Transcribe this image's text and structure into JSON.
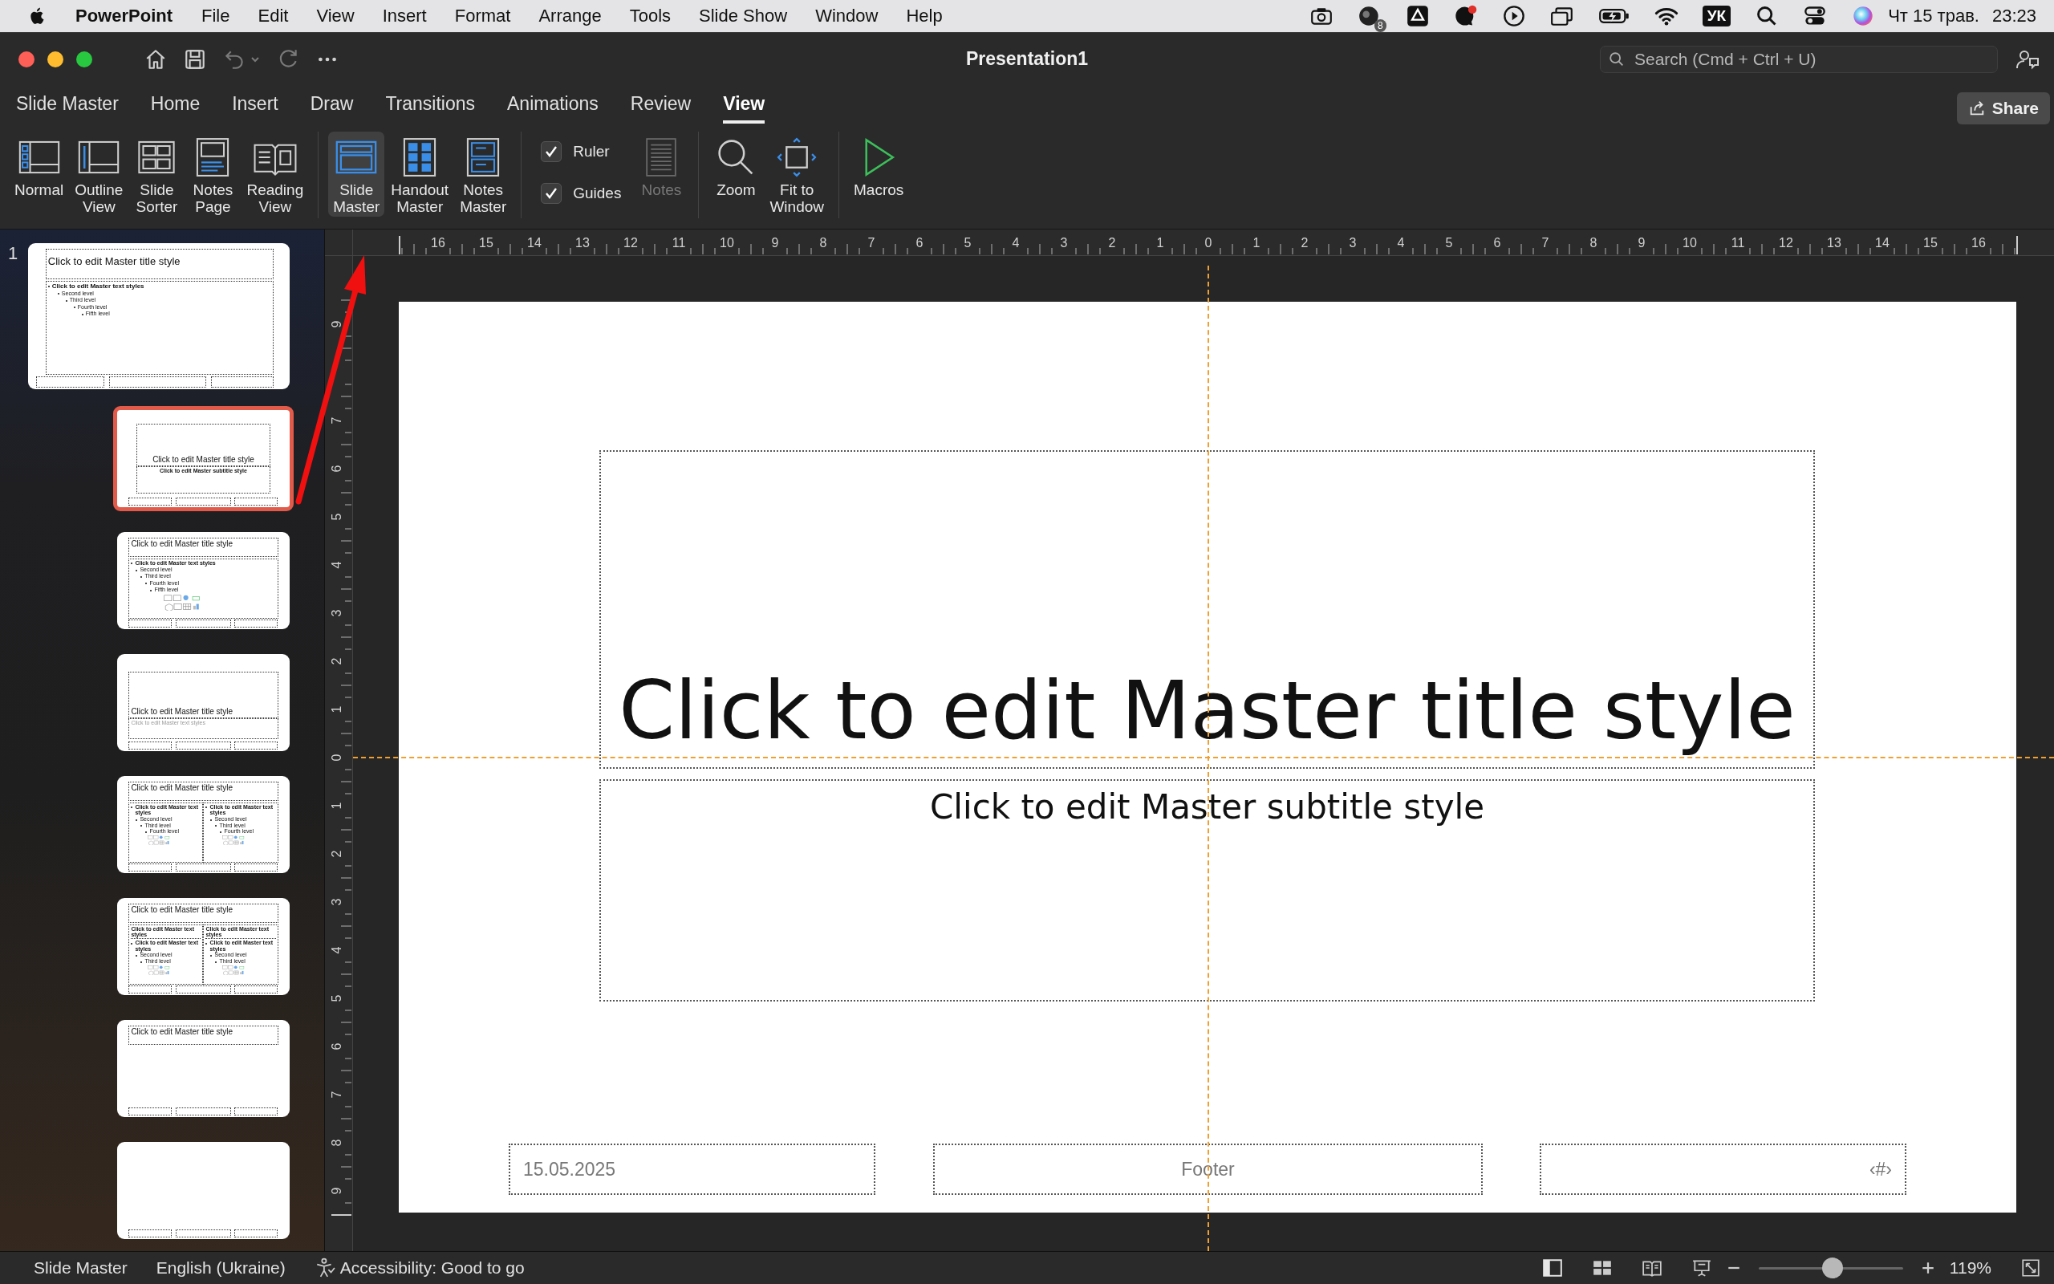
{
  "menubar": {
    "app_name": "PowerPoint",
    "menus": [
      "File",
      "Edit",
      "View",
      "Insert",
      "Format",
      "Arrange",
      "Tools",
      "Slide Show",
      "Window",
      "Help"
    ],
    "notification_badge": "8",
    "input_source": "УК",
    "date": "Чт 15 трав.",
    "time": "23:23"
  },
  "window": {
    "title": "Presentation1",
    "search": {
      "placeholder": "Search (Cmd + Ctrl + U)"
    }
  },
  "tabs": [
    {
      "label": "Slide Master",
      "selected": false
    },
    {
      "label": "Home",
      "selected": false
    },
    {
      "label": "Insert",
      "selected": false
    },
    {
      "label": "Draw",
      "selected": false
    },
    {
      "label": "Transitions",
      "selected": false
    },
    {
      "label": "Animations",
      "selected": false
    },
    {
      "label": "Review",
      "selected": false
    },
    {
      "label": "View",
      "selected": true
    }
  ],
  "share_button": "Share",
  "ribbon": {
    "groups": [
      {
        "items": [
          {
            "kind": "button",
            "label": [
              "Normal"
            ],
            "selected": false,
            "disabled": false
          },
          {
            "kind": "button",
            "label": [
              "Outline",
              "View"
            ],
            "selected": false,
            "disabled": false
          },
          {
            "kind": "button",
            "label": [
              "Slide",
              "Sorter"
            ],
            "selected": false,
            "disabled": false
          },
          {
            "kind": "button",
            "label": [
              "Notes",
              "Page"
            ],
            "selected": false,
            "disabled": false
          },
          {
            "kind": "button",
            "label": [
              "Reading",
              "View"
            ],
            "selected": false,
            "disabled": false
          }
        ]
      },
      {
        "items": [
          {
            "kind": "button",
            "label": [
              "Slide",
              "Master"
            ],
            "selected": true,
            "disabled": false
          },
          {
            "kind": "button",
            "label": [
              "Handout",
              "Master"
            ],
            "selected": false,
            "disabled": false
          },
          {
            "kind": "button",
            "label": [
              "Notes",
              "Master"
            ],
            "selected": false,
            "disabled": false
          }
        ]
      },
      {
        "items": [
          {
            "kind": "checkbox",
            "label": "Ruler",
            "checked": true
          },
          {
            "kind": "checkbox",
            "label": "Guides",
            "checked": true
          },
          {
            "kind": "button",
            "label": [
              "Notes"
            ],
            "selected": false,
            "disabled": true
          }
        ]
      },
      {
        "items": [
          {
            "kind": "button",
            "label": [
              "Zoom"
            ],
            "selected": false,
            "disabled": false
          },
          {
            "kind": "button",
            "label": [
              "Fit to",
              "Window"
            ],
            "selected": false,
            "disabled": false
          }
        ]
      },
      {
        "items": [
          {
            "kind": "button",
            "label": [
              "Macros"
            ],
            "selected": false,
            "disabled": false
          }
        ]
      }
    ]
  },
  "ruler": {
    "horizontal": [
      "16",
      "15",
      "14",
      "13",
      "12",
      "11",
      "10",
      "9",
      "8",
      "7",
      "6",
      "5",
      "4",
      "3",
      "2",
      "1",
      "0",
      "1",
      "2",
      "3",
      "4",
      "5",
      "6",
      "7",
      "8",
      "9",
      "10",
      "11",
      "12",
      "13",
      "14",
      "15",
      "16"
    ],
    "vertical": [
      "9",
      "7",
      "6",
      "5",
      "4",
      "3",
      "2",
      "1",
      "0",
      "1",
      "2",
      "3",
      "4",
      "5",
      "6",
      "7",
      "8",
      "9"
    ]
  },
  "thumbnails": [
    {
      "kind": "master",
      "number": "1",
      "selected": false,
      "title": "Click to edit Master title style",
      "body": [
        {
          "text": "Click to edit Master text styles",
          "children": [
            {
              "text": "Second level",
              "children": [
                {
                  "text": "Third level",
                  "children": [
                    {
                      "text": "Fourth level",
                      "children": [
                        {
                          "text": "Fifth level"
                        }
                      ]
                    }
                  ]
                }
              ]
            }
          ]
        }
      ]
    },
    {
      "kind": "title",
      "selected": true,
      "title": "Click to edit Master title style",
      "subtitle": "Click to edit Master subtitle style"
    },
    {
      "kind": "content",
      "selected": false,
      "title": "Click to edit Master title style",
      "body": [
        {
          "text": "Click to edit Master text styles",
          "children": [
            {
              "text": "Second level",
              "children": [
                {
                  "text": "Third level",
                  "children": [
                    {
                      "text": "Fourth level",
                      "children": [
                        {
                          "text": "Fifth level"
                        }
                      ]
                    }
                  ]
                }
              ]
            }
          ]
        }
      ]
    },
    {
      "kind": "section",
      "selected": false,
      "title": "Click to edit Master title style",
      "text": "Click to edit Master text styles"
    },
    {
      "kind": "two_content",
      "selected": false,
      "title": "Click to edit Master title style",
      "columns": [
        {
          "body": [
            {
              "text": "Click to edit Master text styles",
              "children": [
                {
                  "text": "Second level",
                  "children": [
                    {
                      "text": "Third level",
                      "children": [
                        {
                          "text": "Fourth level"
                        }
                      ]
                    }
                  ]
                }
              ]
            }
          ]
        },
        {
          "body": [
            {
              "text": "Click to edit Master text styles",
              "children": [
                {
                  "text": "Second level",
                  "children": [
                    {
                      "text": "Third level",
                      "children": [
                        {
                          "text": "Fourth level"
                        }
                      ]
                    }
                  ]
                }
              ]
            }
          ]
        }
      ]
    },
    {
      "kind": "comparison",
      "selected": false,
      "title": "Click to edit Master title style",
      "columns": [
        {
          "heading": "Click to edit Master text styles",
          "body": [
            {
              "text": "Click to edit Master text styles",
              "children": [
                {
                  "text": "Second level",
                  "children": [
                    {
                      "text": "Third level"
                    }
                  ]
                }
              ]
            }
          ]
        },
        {
          "heading": "Click to edit Master text styles",
          "body": [
            {
              "text": "Click to edit Master text styles",
              "children": [
                {
                  "text": "Second level",
                  "children": [
                    {
                      "text": "Third level"
                    }
                  ]
                }
              ]
            }
          ]
        }
      ]
    },
    {
      "kind": "title_only",
      "selected": false,
      "title": "Click to edit Master title style"
    },
    {
      "kind": "blank",
      "selected": false
    }
  ],
  "slide": {
    "title": "Click to edit Master title style",
    "subtitle": "Click to edit Master subtitle style",
    "date": "15.05.2025",
    "footer": "Footer",
    "slide_number": "‹#›"
  },
  "status_bar": {
    "mode": "Slide Master",
    "language": "English (Ukraine)",
    "accessibility": "Accessibility: Good to go",
    "zoom_slider": {
      "level": 0.51
    },
    "zoom": "119%"
  }
}
